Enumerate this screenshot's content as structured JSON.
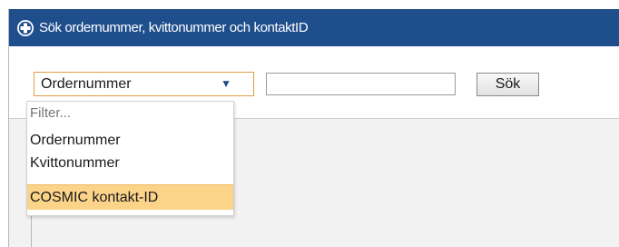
{
  "header": {
    "title": "Sök ordernummer, kvittonummer och kontaktID",
    "icon": "plus-circle-icon"
  },
  "search": {
    "type_selected": "Ordernummer",
    "input_value": "",
    "button_label": "Sök"
  },
  "dropdown": {
    "filter_placeholder": "Filter...",
    "options": [
      "Ordernummer",
      "Kvittonummer",
      "COSMIC kontakt-ID"
    ],
    "highlighted_index": 2
  },
  "colors": {
    "titlebar": "#1f4e8c",
    "select_border": "#e0a040",
    "highlight": "#fbd48a"
  }
}
